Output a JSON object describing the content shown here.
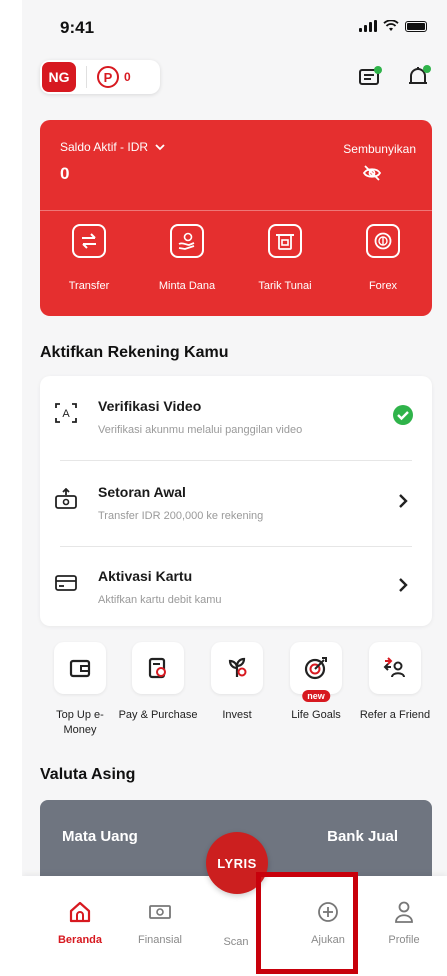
{
  "status_bar": {
    "time": "9:41"
  },
  "header": {
    "avatar_initials": "NG",
    "points_symbol": "P",
    "points": "0"
  },
  "balance": {
    "label": "Saldo Aktif - IDR",
    "value": "0",
    "hide_label": "Sembunyikan",
    "actions": [
      {
        "label": "Transfer",
        "icon": "transfer-icon"
      },
      {
        "label": "Minta Dana",
        "icon": "request-money-icon"
      },
      {
        "label": "Tarik Tunai",
        "icon": "atm-icon"
      },
      {
        "label": "Forex",
        "icon": "forex-icon"
      }
    ]
  },
  "activation": {
    "title": "Aktifkan Rekening Kamu",
    "items": [
      {
        "title": "Verifikasi Video",
        "subtitle": "Verifikasi akunmu melalui panggilan video",
        "status": "done"
      },
      {
        "title": "Setoran Awal",
        "subtitle": "Transfer IDR 200,000 ke rekening",
        "status": "pending"
      },
      {
        "title": "Aktivasi Kartu",
        "subtitle": "Aktifkan kartu debit kamu",
        "status": "pending"
      }
    ]
  },
  "menu": [
    {
      "label": "Top Up e-Money",
      "icon": "wallet-icon"
    },
    {
      "label": "Pay & Purchase",
      "icon": "bill-icon"
    },
    {
      "label": "Invest",
      "icon": "plant-icon"
    },
    {
      "label": "Life Goals",
      "icon": "target-icon",
      "badge": "new"
    },
    {
      "label": "Refer a Friend",
      "icon": "refer-icon"
    }
  ],
  "valuta": {
    "title": "Valuta Asing",
    "col_left": "Mata Uang",
    "col_right": "Bank Jual"
  },
  "bottom_nav": {
    "scan_logo": "LYRIS",
    "items": [
      {
        "label": "Beranda",
        "icon": "home-icon",
        "active": true
      },
      {
        "label": "Finansial",
        "icon": "cash-icon",
        "active": false
      },
      {
        "label": "Scan",
        "icon": "scan-icon",
        "active": false
      },
      {
        "label": "Ajukan",
        "icon": "plus-circle-icon",
        "active": false
      },
      {
        "label": "Profile",
        "icon": "profile-icon",
        "active": false
      }
    ]
  },
  "colors": {
    "brand_red": "#e52f2f",
    "dark_red": "#d71920",
    "success_green": "#2fb34a",
    "highlight": "#c8000b"
  }
}
